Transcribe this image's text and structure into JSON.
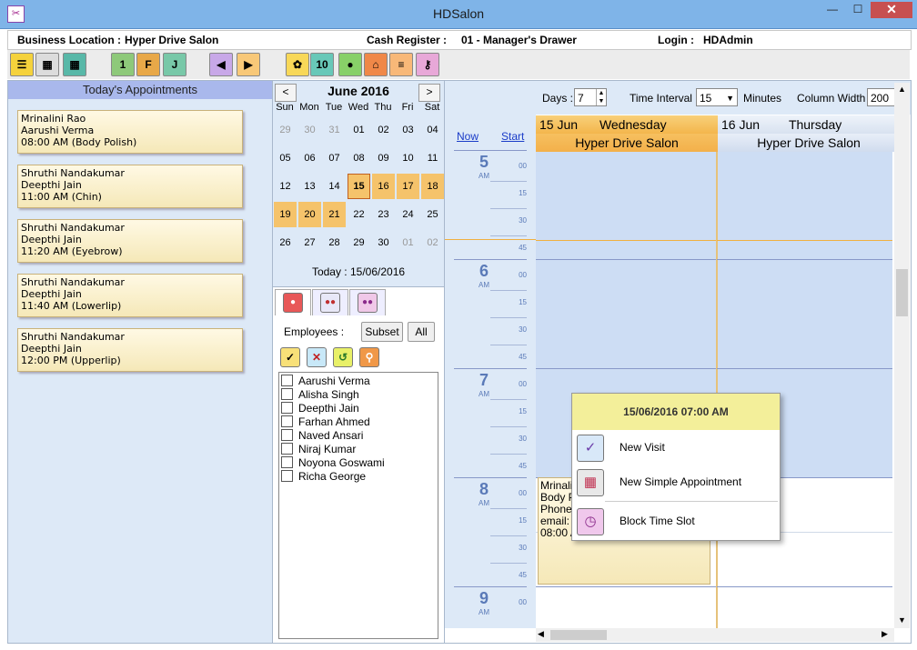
{
  "window": {
    "title": "HDSalon",
    "minimize": "—",
    "maximize": "☐",
    "close": "✕"
  },
  "info": {
    "business_location_label": "Business Location :",
    "business_location_value": "Hyper Drive Salon",
    "cash_register_label": "Cash Register :",
    "cash_register_value": "01 - Manager's Drawer",
    "login_label": "Login :",
    "login_value": "HDAdmin"
  },
  "toolbar": {
    "buttons": [
      {
        "icon": "menu-icon",
        "glyph": "☰",
        "bg": "#f5d23c"
      },
      {
        "icon": "calculator-icon",
        "glyph": "▦",
        "bg": "#dcdcdc"
      },
      {
        "icon": "calendar-month-icon",
        "glyph": "▦",
        "bg": "#58b8a8"
      },
      {
        "icon": "calendar-day-icon",
        "glyph": "1",
        "bg": "#8ec97a"
      },
      {
        "icon": "calendar-fri-icon",
        "glyph": "F",
        "bg": "#e8a848"
      },
      {
        "icon": "calendar-jan-icon",
        "glyph": "J",
        "bg": "#78c8a8"
      },
      {
        "icon": "back-arrow-icon",
        "glyph": "◀",
        "bg": "#c8a8e8"
      },
      {
        "icon": "forward-arrow-icon",
        "glyph": "▶",
        "bg": "#f8c878"
      },
      {
        "icon": "settings-gear-icon",
        "glyph": "✿",
        "bg": "#f8d858"
      },
      {
        "icon": "calendar-10-icon",
        "glyph": "10",
        "bg": "#68c8b8"
      },
      {
        "icon": "user-icon",
        "glyph": "●",
        "bg": "#88d068"
      },
      {
        "icon": "home-icon",
        "glyph": "⌂",
        "bg": "#f08848"
      },
      {
        "icon": "notes-icon",
        "glyph": "≡",
        "bg": "#f8b878"
      },
      {
        "icon": "key-icon",
        "glyph": "⚷",
        "bg": "#e8a8d8"
      }
    ]
  },
  "appointments": {
    "header": "Today's Appointments",
    "items": [
      {
        "client": "Mrinalini Rao",
        "staff": "Aarushi Verma",
        "time": "08:00 AM (Body Polish)"
      },
      {
        "client": "Shruthi Nandakumar",
        "staff": "Deepthi Jain",
        "time": "11:00 AM (Chin)"
      },
      {
        "client": "Shruthi Nandakumar",
        "staff": "Deepthi Jain",
        "time": "11:20 AM (Eyebrow)"
      },
      {
        "client": "Shruthi Nandakumar",
        "staff": "Deepthi Jain",
        "time": "11:40 AM (Lowerlip)"
      },
      {
        "client": "Shruthi Nandakumar",
        "staff": "Deepthi Jain",
        "time": "12:00 PM (Upperlip)"
      }
    ]
  },
  "calendar": {
    "title": "June 2016",
    "prev": "<",
    "next": ">",
    "dow": [
      "Sun",
      "Mon",
      "Tue",
      "Wed",
      "Thu",
      "Fri",
      "Sat"
    ],
    "weeks": [
      [
        "29",
        "30",
        "31",
        "01",
        "02",
        "03",
        "04"
      ],
      [
        "05",
        "06",
        "07",
        "08",
        "09",
        "10",
        "11"
      ],
      [
        "12",
        "13",
        "14",
        "15",
        "16",
        "17",
        "18"
      ],
      [
        "19",
        "20",
        "21",
        "22",
        "23",
        "24",
        "25"
      ],
      [
        "26",
        "27",
        "28",
        "29",
        "30",
        "01",
        "02"
      ]
    ],
    "today_text": "Today : 15/06/2016"
  },
  "employees": {
    "label": "Employees :",
    "subset": "Subset",
    "all": "All",
    "list": [
      "Aarushi Verma",
      "Alisha Singh",
      "Deepthi Jain",
      "Farhan Ahmed",
      "Naved Ansari",
      "Niraj Kumar",
      "Noyona Goswami",
      "Richa George"
    ]
  },
  "scheduler": {
    "days_label": "Days :",
    "days_value": "7",
    "interval_label": "Time Interval :",
    "interval_value": "15",
    "minutes_label": "Minutes",
    "colwidth_label": "Column Width :",
    "colwidth_value": "200",
    "now_link": "Now",
    "start_link": "Start",
    "columns": [
      {
        "date": "15 Jun",
        "weekday": "Wednesday",
        "location": "Hyper Drive Salon"
      },
      {
        "date": "16 Jun",
        "weekday": "Thursday",
        "location": "Hyper Drive Salon"
      }
    ],
    "hours": [
      "5",
      "6",
      "7",
      "8",
      "9"
    ],
    "am": "AM",
    "minutes": [
      "00",
      "15",
      "30",
      "45"
    ],
    "appointment_lines": [
      "Mrinalini Rao",
      "Body Polish",
      "Phone:",
      "email:",
      "08:00 AM"
    ]
  },
  "context_menu": {
    "header": "15/06/2016 07:00 AM",
    "items": [
      "New Visit",
      "New Simple Appointment",
      "Block Time Slot"
    ]
  }
}
